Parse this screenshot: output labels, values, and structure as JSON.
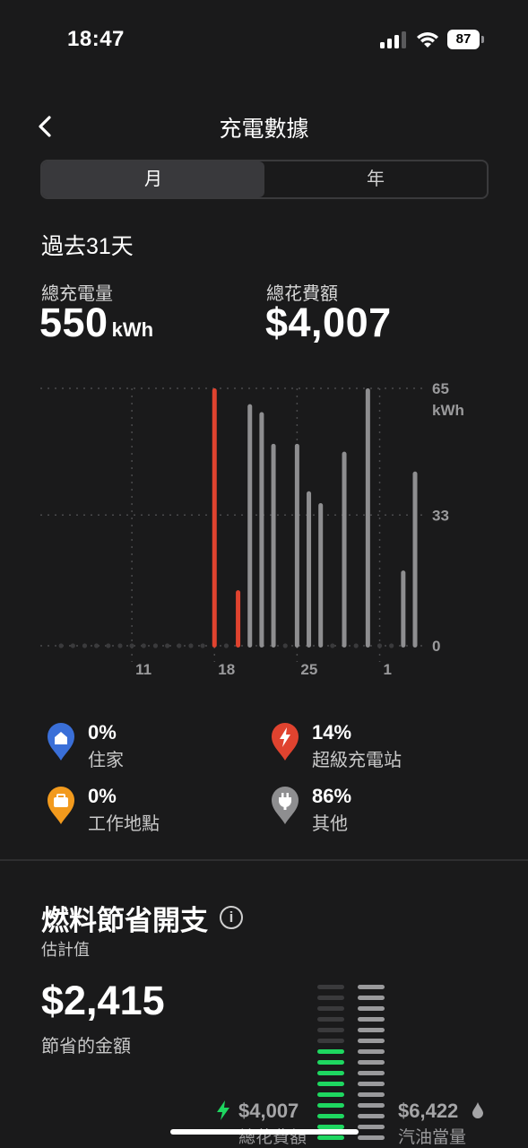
{
  "status_bar": {
    "time": "18:47",
    "battery": "87"
  },
  "header": {
    "title": "充電數據"
  },
  "segmented": {
    "month": "月",
    "year": "年"
  },
  "period_label": "過去31天",
  "totals": {
    "energy_label": "總充電量",
    "energy_value": "550",
    "energy_unit": "kWh",
    "cost_label": "總花費額",
    "cost_value": "$4,007"
  },
  "chart_data": {
    "type": "bar",
    "title": "",
    "ylabel": "kWh",
    "ylim": [
      0,
      65
    ],
    "y_ticks": [
      "65",
      "33",
      "0"
    ],
    "y_unit": "kWh",
    "x_ticks": [
      "11",
      "18",
      "25",
      "1"
    ],
    "x_tick_days": [
      11,
      18,
      25,
      32
    ],
    "x_range": [
      4,
      35
    ],
    "colors": {
      "supercharger": "#e0432f",
      "other": "#8e8e90",
      "empty": "#3a3a3c",
      "grid": "#4a4a4c"
    },
    "series": [
      {
        "name": "超級充電站",
        "points": [
          {
            "day": 18,
            "kwh": 65
          },
          {
            "day": 20,
            "kwh": 14
          }
        ]
      },
      {
        "name": "其他",
        "points": [
          {
            "day": 21,
            "kwh": 61
          },
          {
            "day": 22,
            "kwh": 59
          },
          {
            "day": 23,
            "kwh": 51
          },
          {
            "day": 25,
            "kwh": 51
          },
          {
            "day": 26,
            "kwh": 39
          },
          {
            "day": 27,
            "kwh": 36
          },
          {
            "day": 29,
            "kwh": 49
          },
          {
            "day": 31,
            "kwh": 65
          },
          {
            "day": 34,
            "kwh": 19
          },
          {
            "day": 35,
            "kwh": 44
          }
        ]
      }
    ],
    "empty_days": [
      5,
      6,
      7,
      8,
      9,
      10,
      11,
      12,
      13,
      14,
      15,
      16,
      17,
      19,
      24,
      28,
      30,
      32,
      33
    ]
  },
  "locations": [
    {
      "pct": "0%",
      "label": "住家",
      "icon": "home-pin-icon",
      "color": "#3a6fd8"
    },
    {
      "pct": "14%",
      "label": "超級充電站",
      "icon": "supercharger-pin-icon",
      "color": "#e0432f"
    },
    {
      "pct": "0%",
      "label": "工作地點",
      "icon": "work-pin-icon",
      "color": "#f29a1d"
    },
    {
      "pct": "86%",
      "label": "其他",
      "icon": "plug-pin-icon",
      "color": "#8e8e90"
    }
  ],
  "savings": {
    "title": "燃料節省開支",
    "info": "i",
    "estimate_label": "估計值",
    "amount": "$2,415",
    "amount_label": "節省的金額",
    "total_cost_value": "$4,007",
    "total_cost_label": "總花費額",
    "fuel_value": "$6,422",
    "fuel_label": "汽油當量",
    "cost_fraction": 0.62,
    "green": "#1ed760"
  }
}
